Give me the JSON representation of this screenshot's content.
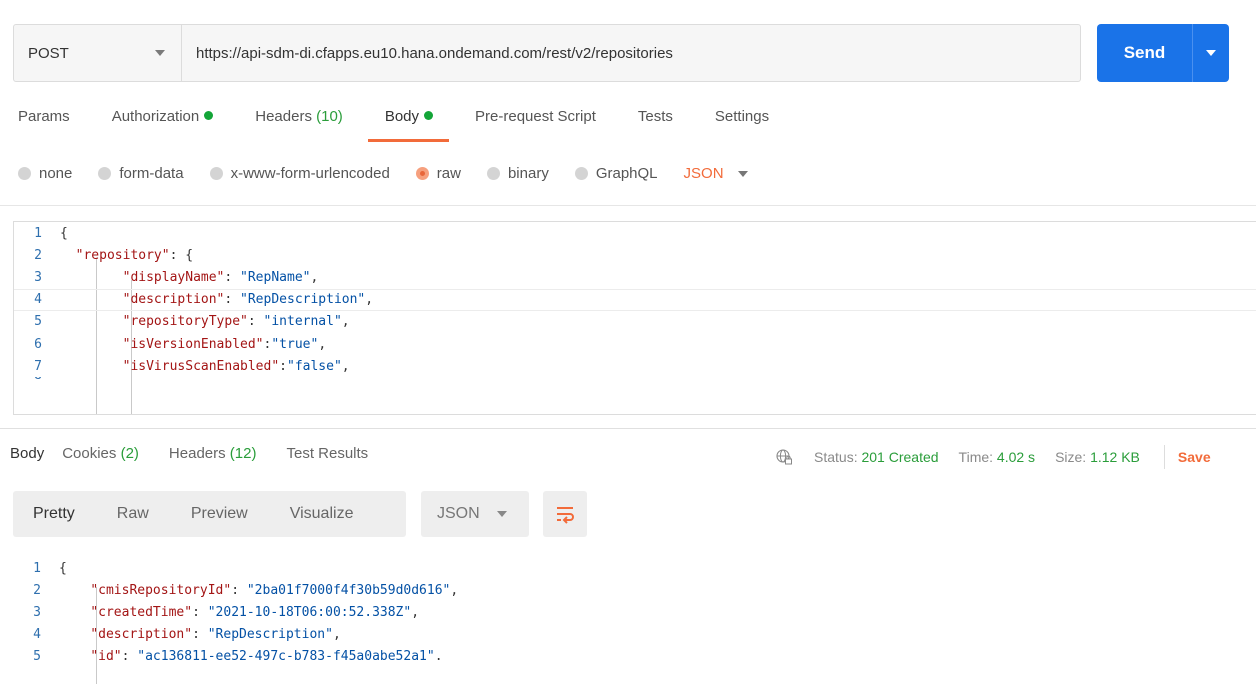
{
  "request": {
    "method": "POST",
    "url": "https://api-sdm-di.cfapps.eu10.hana.ondemand.com/rest/v2/repositories",
    "send_label": "Send"
  },
  "request_tabs": {
    "params": "Params",
    "authorization": "Authorization",
    "headers": "Headers",
    "headers_count": "(10)",
    "body": "Body",
    "pre_request": "Pre-request Script",
    "tests": "Tests",
    "settings": "Settings"
  },
  "body_types": {
    "none": "none",
    "form_data": "form-data",
    "urlencoded": "x-www-form-urlencoded",
    "raw": "raw",
    "binary": "binary",
    "graphql": "GraphQL",
    "language": "JSON",
    "selected": "raw"
  },
  "request_body": [
    {
      "n": "1",
      "indent": "",
      "key": "",
      "value": "",
      "tail": "{"
    },
    {
      "n": "2",
      "indent": "  ",
      "key": "\"repository\"",
      "sep": ": ",
      "value": "",
      "tail": "{"
    },
    {
      "n": "3",
      "indent": "        ",
      "key": "\"displayName\"",
      "sep": ": ",
      "value": "\"RepName\"",
      "tail": ","
    },
    {
      "n": "4",
      "indent": "        ",
      "key": "\"description\"",
      "sep": ": ",
      "value": "\"RepDescription\"",
      "tail": ","
    },
    {
      "n": "5",
      "indent": "        ",
      "key": "\"repositoryType\"",
      "sep": ": ",
      "value": "\"internal\"",
      "tail": ","
    },
    {
      "n": "6",
      "indent": "        ",
      "key": "\"isVersionEnabled\"",
      "sep": ":",
      "value": "\"true\"",
      "tail": ","
    },
    {
      "n": "7",
      "indent": "        ",
      "key": "\"isVirusScanEnabled\"",
      "sep": ":",
      "value": "\"false\"",
      "tail": ","
    }
  ],
  "response_tabs": {
    "body": "Body",
    "cookies": "Cookies",
    "cookies_count": "(2)",
    "headers": "Headers",
    "headers_count": "(12)",
    "test_results": "Test Results"
  },
  "response_status": {
    "status_label": "Status:",
    "status_value": "201 Created",
    "time_label": "Time:",
    "time_value": "4.02 s",
    "size_label": "Size:",
    "size_value": "1.12 KB",
    "save_label": "Save"
  },
  "view_modes": {
    "pretty": "Pretty",
    "raw": "Raw",
    "preview": "Preview",
    "visualize": "Visualize",
    "format": "JSON"
  },
  "response_body": [
    {
      "n": "1",
      "indent": "",
      "key": "",
      "sep": "",
      "value": "",
      "tail": "{"
    },
    {
      "n": "2",
      "indent": "    ",
      "key": "\"cmisRepositoryId\"",
      "sep": ": ",
      "value": "\"2ba01f7000f4f30b59d0d616\"",
      "tail": ","
    },
    {
      "n": "3",
      "indent": "    ",
      "key": "\"createdTime\"",
      "sep": ": ",
      "value": "\"2021-10-18T06:00:52.338Z\"",
      "tail": ","
    },
    {
      "n": "4",
      "indent": "    ",
      "key": "\"description\"",
      "sep": ": ",
      "value": "\"RepDescription\"",
      "tail": ","
    },
    {
      "n": "5",
      "indent": "    ",
      "key": "\"id\"",
      "sep": ": ",
      "value": "\"ac136811-ee52-497c-b783-f45a0abe52a1\"",
      "tail": "."
    }
  ],
  "colors": {
    "accent": "#f26b3a",
    "send": "#1a73e8",
    "status_green": "#2a9d3a"
  }
}
